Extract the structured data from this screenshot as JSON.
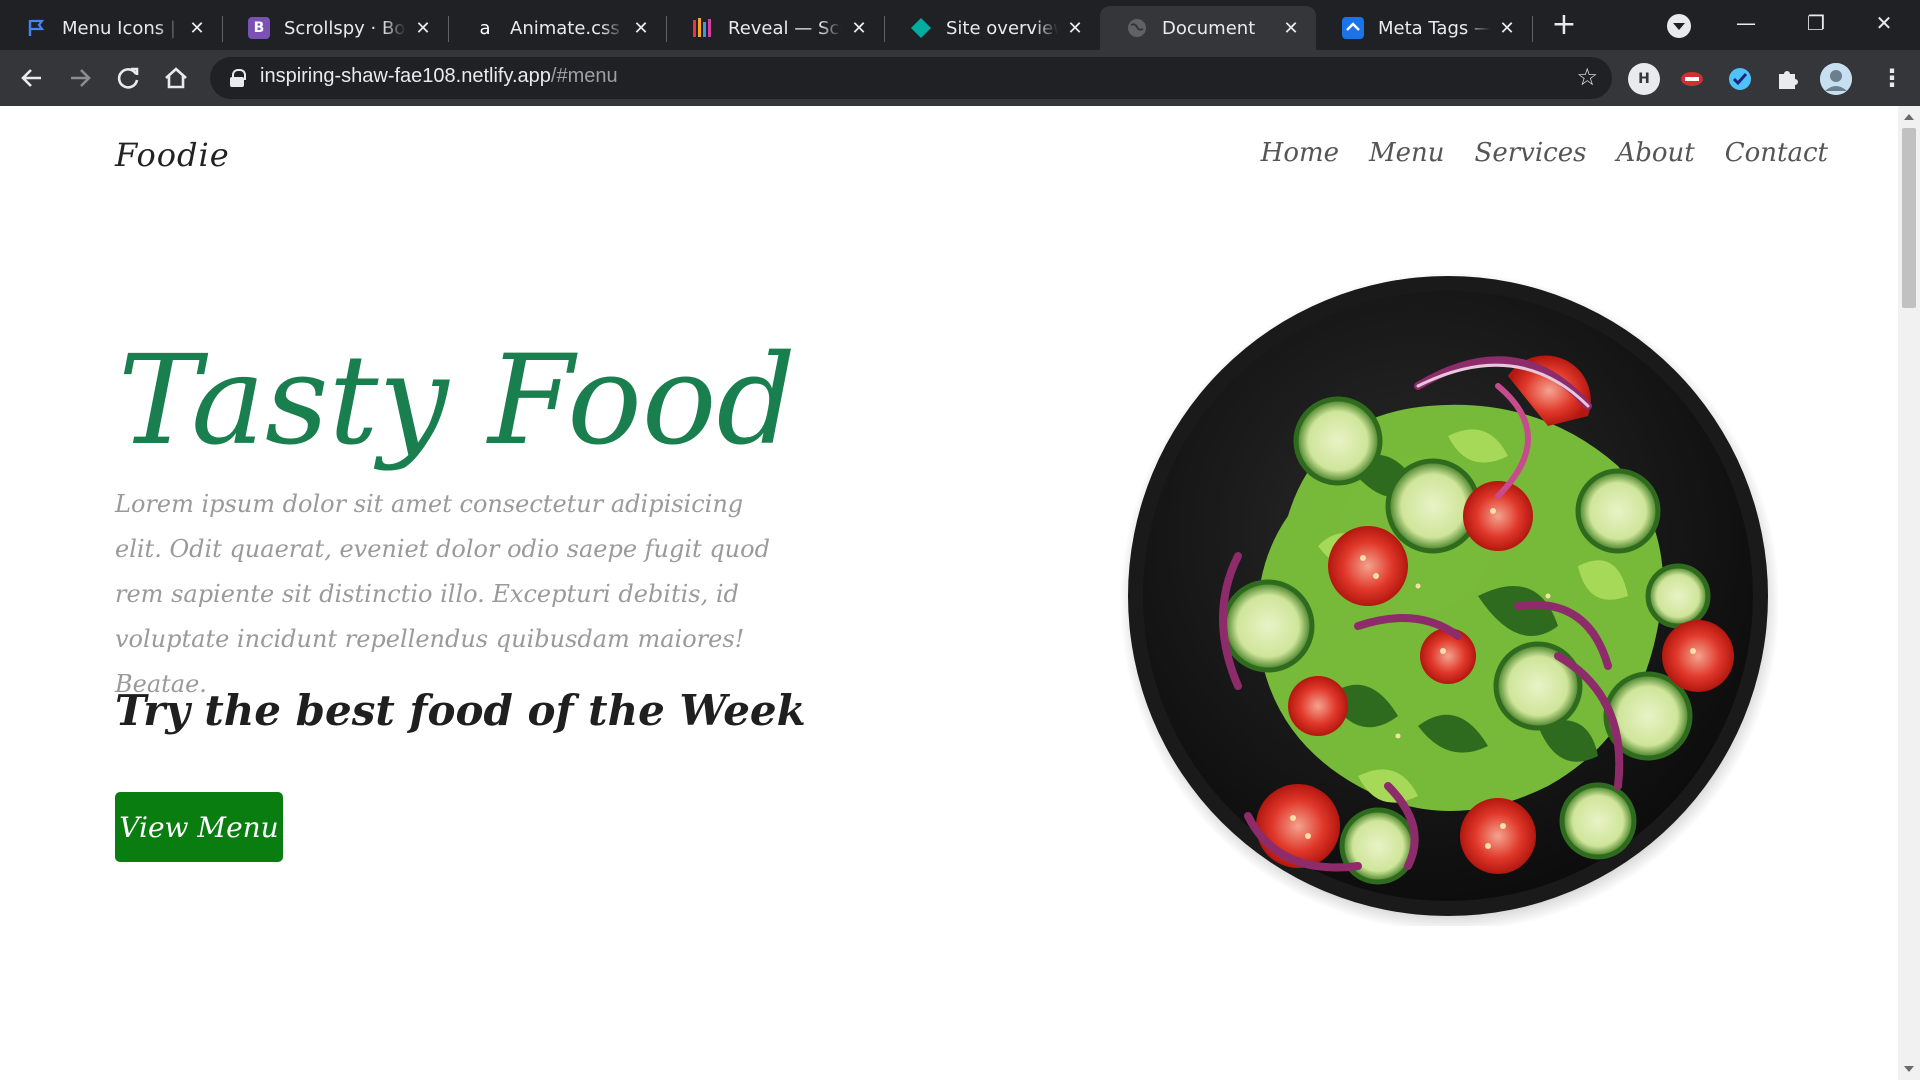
{
  "browser": {
    "tabs": [
      {
        "title": "Menu Icons | Font Awesome",
        "favicon": "flag-icon",
        "favicon_color": "#4285f4",
        "active": false
      },
      {
        "title": "Scrollspy · Bootstrap",
        "favicon": "bootstrap-icon",
        "favicon_text": "B",
        "favicon_color": "#7952b3",
        "active": false
      },
      {
        "title": "Animate.css | A cross-browser library",
        "favicon": "animate-icon",
        "favicon_text": "a",
        "active": false
      },
      {
        "title": "Reveal — ScrollReveal",
        "favicon": "reveal-icon",
        "active": false
      },
      {
        "title": "Site overview | Netlify",
        "favicon": "netlify-icon",
        "favicon_color": "#00ad9f",
        "active": false
      },
      {
        "title": "Document",
        "favicon": "globe-icon",
        "active": true
      },
      {
        "title": "Meta Tags — Preview",
        "favicon": "metatags-icon",
        "favicon_color": "#1a73e8",
        "active": false
      }
    ],
    "new_tab_label": "+",
    "url": {
      "host": "inspiring-shaw-fae108.netlify.app",
      "path": "/#menu"
    },
    "window_controls": {
      "minimize": "—",
      "restore": "❐",
      "close": "✕"
    }
  },
  "site": {
    "brand": "Foodie",
    "nav": [
      "Home",
      "Menu",
      "Services",
      "About",
      "Contact"
    ],
    "hero": {
      "title": "Tasty Food",
      "paragraph": "Lorem ipsum dolor sit amet consectetur adipisicing elit. Odit quaerat, eveniet dolor odio saepe fugit quod rem sapiente sit distinctio illo. Excepturi debitis, id voluptate incidunt repellendus quibusdam maiores! Beatae.",
      "subtitle": "Try the best food of the Week",
      "button": "View Menu"
    },
    "image": {
      "subject": "salad-bowl-image"
    },
    "colors": {
      "title_green": "#1a7f4e",
      "button_green": "#0a7d10",
      "paragraph_gray": "#9a9a9a"
    }
  }
}
